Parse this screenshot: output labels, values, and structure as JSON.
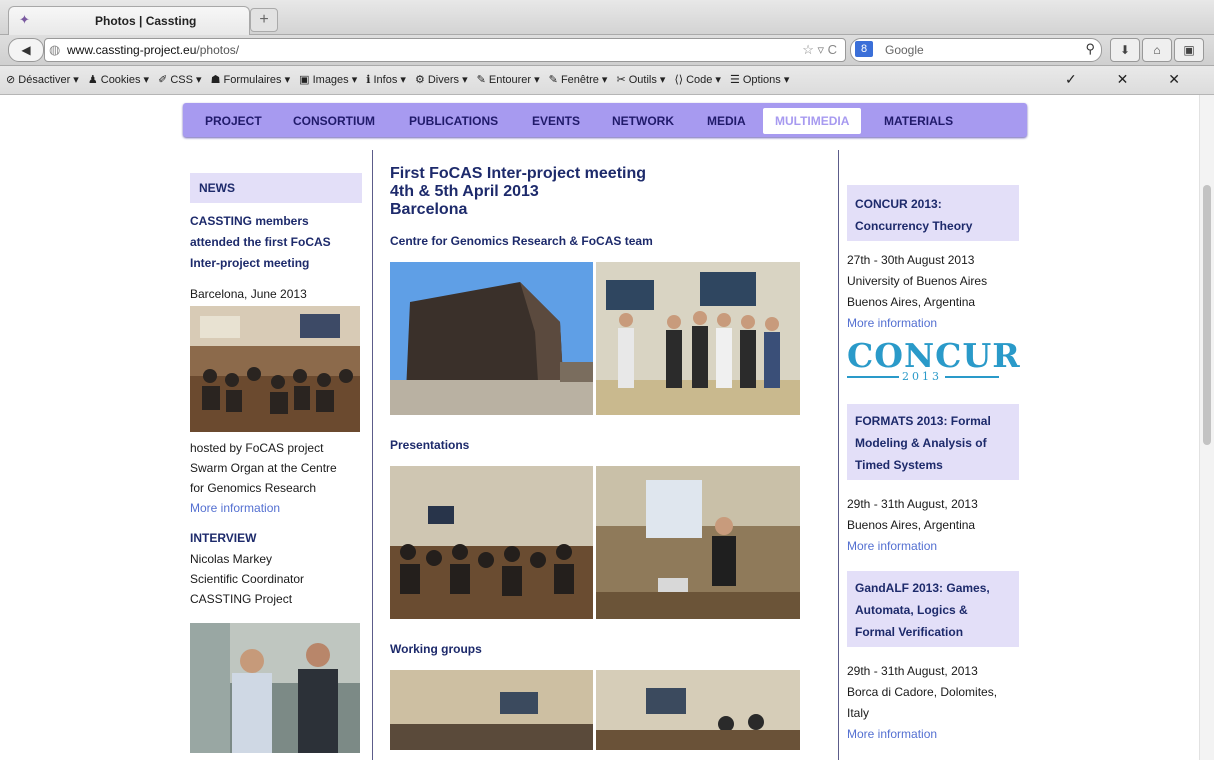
{
  "browser": {
    "tab_title": "Photos | Cassting",
    "new_tab": "+",
    "url_domain": "www.cassting-project.eu",
    "url_path": "/photos/",
    "search_engine": "8",
    "search_placeholder": "Google",
    "dev_toolbar": [
      "Désactiver ▾",
      "Cookies ▾",
      "CSS ▾",
      "Formulaires ▾",
      "Images ▾",
      "Infos ▾",
      "Divers ▾",
      "Entourer ▾",
      "Fenêtre ▾",
      "Outils ▾",
      "Code ▾",
      "Options ▾"
    ],
    "dev_right": "✓ ✕ ✕"
  },
  "menu": {
    "items": [
      "PROJECT",
      "CONSORTIUM",
      "PUBLICATIONS",
      "EVENTS",
      "NETWORK",
      "MEDIA",
      "MULTIMEDIA",
      "MATERIALS"
    ],
    "active": "MULTIMEDIA"
  },
  "left": {
    "news_heading": "NEWS",
    "news_title_1": "CASSTING members",
    "news_title_2": "attended the first FoCAS",
    "news_title_3": "Inter-project meeting",
    "news_place": "Barcelona, June 2013",
    "news_text_1": "hosted by FoCAS project",
    "news_text_2": "Swarm Organ at the Centre",
    "news_text_3": "for Genomics Research",
    "news_more": "More information",
    "interview_heading": "INTERVIEW",
    "interview_1": "Nicolas Markey",
    "interview_2": "Scientific Coordinator",
    "interview_3": "CASSTING Project"
  },
  "center": {
    "title_1": "First FoCAS Inter-project meeting",
    "title_2": "4th & 5th April 2013",
    "title_3": "Barcelona",
    "section_1": "Centre for Genomics Research & FoCAS team",
    "section_2": "Presentations",
    "section_3": "Working groups"
  },
  "right": {
    "ev1_title_1": "CONCUR 2013:",
    "ev1_title_2": "Concurrency Theory",
    "ev1_date": "27th - 30th August 2013",
    "ev1_place_1": "University of Buenos Aires",
    "ev1_place_2": "Buenos Aires, Argentina",
    "ev1_more": "More information",
    "concur_logo": "CONCUR",
    "concur_year": "2013",
    "ev2_title_1": "FORMATS 2013: Formal",
    "ev2_title_2": "Modeling & Analysis of",
    "ev2_title_3": "Timed Systems",
    "ev2_date": "29th - 31th August, 2013",
    "ev2_place": "Buenos Aires, Argentina",
    "ev2_more": "More information",
    "ev3_title_1": "GandALF 2013: Games,",
    "ev3_title_2": "Automata, Logics &",
    "ev3_title_3": "Formal Verification",
    "ev3_date": "29th - 31th August, 2013",
    "ev3_place_1": "Borca di Cadore, Dolomites,",
    "ev3_place_2": "Italy",
    "ev3_more": "More information"
  },
  "colors": {
    "menu_bg": "#a79af0",
    "box_bg": "#e3dff8",
    "heading": "#1d2a6b",
    "link": "#5470d1"
  }
}
